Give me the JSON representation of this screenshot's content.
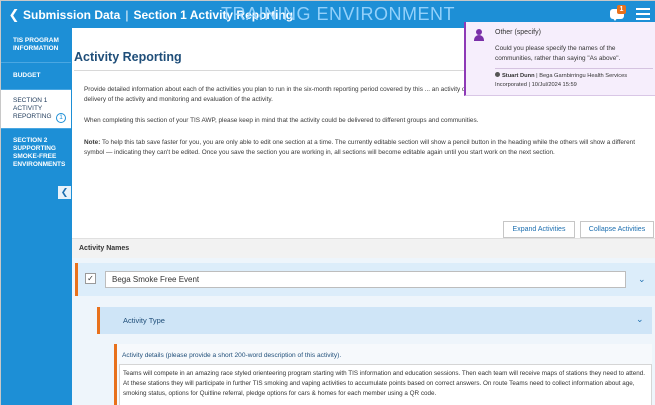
{
  "header": {
    "breadcrumb_root": "Submission Data",
    "breadcrumb_section": "Section 1 Activity Reporting",
    "watermark": "TRAINING ENVIRONMENT",
    "notification_count": "1"
  },
  "sidebar": {
    "items": [
      {
        "label": "TIS PROGRAM INFORMATION"
      },
      {
        "label": "BUDGET"
      },
      {
        "label": "SECTION 1 ACTIVITY REPORTING"
      },
      {
        "label": "SECTION 2 SUPPORTING SMOKE-FREE ENVIRONMENTS"
      }
    ],
    "active_badge": "1"
  },
  "main": {
    "heading": "Activity Reporting",
    "intro": "Provide detailed information about each of the activities you plan to run in the six-month reporting period covered by this ... an activity description, as well as information about the design of the activity, delivery of the activity and monitoring and evaluation of the activity.",
    "intro_line2": "When completing this tab save faster for you, you are only able to edit one section at a time. The currently editable section will show a pencil button in the heading while the others will show a different symbol — indicating they can't be edited. Once you save the section you are working in, all sections will become editable again until you start work on the next section.",
    "note_label": "Note:",
    "note_text": "To help this tab save faster for you, you are only able to edit one section at a time. The currently editable section will show a pencil button in the heading while the others will show a different symbol — indicating they can't be edited. Once you save the section you are working in, all sections will become editable again until you start work on the next section.",
    "completing_text": "When completing this section of your TIS AWP, please keep in mind that the activity could be delivered to different groups and communities.",
    "expand_label": "Expand Activities",
    "collapse_label": "Collapse Activities",
    "activity_names_label": "Activity Names",
    "activity_name": "Bega Smoke Free Event",
    "activity_type_label": "Activity Type",
    "details_title": "Activity details (please provide a short 200-word description of this activity).",
    "details_text": "Teams will compete in an amazing race styled orienteering program starting with TIS information and education sessions. Then each team will receive maps of stations they need to attend. At these stations they will participate in further TIS smoking and vaping activities to accumulate points based on correct answers. On route Teams need to collect information about age, smoking status, options for Quitline referral, pledge options for cars & homes for each member using a QR code."
  },
  "comment": {
    "title": "Other (specify)",
    "text": "Could you please specify the names of the communities, rather than saying \"As above\".",
    "author": "Stuart Dunn",
    "org_line1": "| Bega Garnbirringu Health Services",
    "org_line2": "Incorporated | 10/Jul/2024 15:59"
  }
}
